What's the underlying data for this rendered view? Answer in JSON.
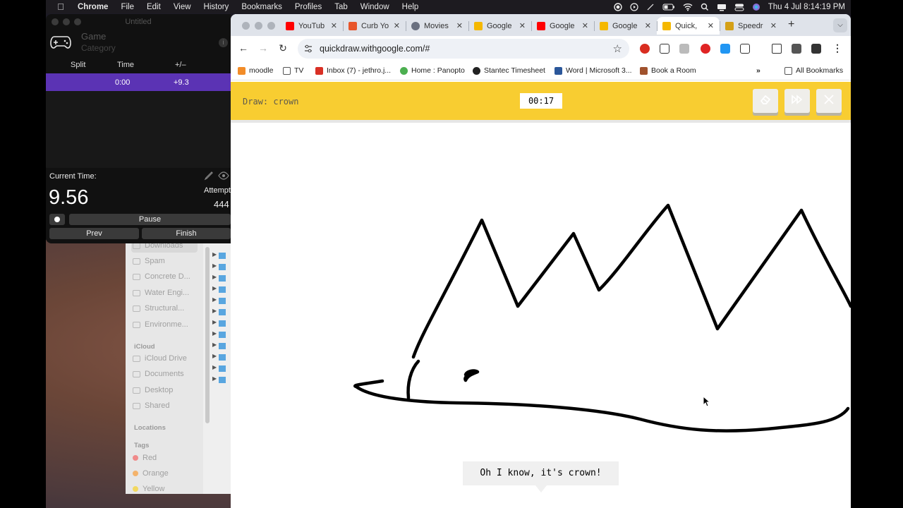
{
  "menubar": {
    "app": "Chrome",
    "items": [
      "File",
      "Edit",
      "View",
      "History",
      "Bookmarks",
      "Profiles",
      "Tab",
      "Window",
      "Help"
    ],
    "clock": "Thu 4 Jul  8:14:19 PM"
  },
  "timer_window": {
    "title": "Untitled",
    "game": "Game",
    "category": "Category",
    "columns": {
      "split": "Split",
      "time": "Time",
      "delta": "+/–"
    },
    "row": {
      "time": "0:00",
      "delta": "+9.3"
    },
    "current_time_label": "Current Time:",
    "current_time": "9.56",
    "attempts_label": "Attempt",
    "attempts": "444",
    "pause": "Pause",
    "prev": "Prev",
    "finish": "Finish"
  },
  "finder": {
    "items": [
      "Downloads",
      "Spam",
      "Concrete D...",
      "Water Engi...",
      "Structural...",
      "Environme..."
    ],
    "icloud_header": "iCloud",
    "icloud": [
      "iCloud Drive",
      "Documents",
      "Desktop",
      "Shared"
    ],
    "locations_header": "Locations",
    "tags_header": "Tags",
    "tags": [
      {
        "name": "Red",
        "color": "#f08a8a"
      },
      {
        "name": "Orange",
        "color": "#f4b36b"
      },
      {
        "name": "Yellow",
        "color": "#f2d860"
      }
    ]
  },
  "tabs": [
    {
      "title": "YouTub",
      "color": "#ff0000"
    },
    {
      "title": "Curb Yo",
      "color": "#e8552b"
    },
    {
      "title": "Movies",
      "color": "#6a7080"
    },
    {
      "title": "Google",
      "color": "#f5b800"
    },
    {
      "title": "Google",
      "color": "#ff0000"
    },
    {
      "title": "Google",
      "color": "#f5b800"
    },
    {
      "title": "Quick,",
      "color": "#f5b800",
      "active": true
    },
    {
      "title": "Speedr",
      "color": "#d4a017"
    }
  ],
  "omnibox": {
    "url": "quickdraw.withgoogle.com/#"
  },
  "bookmarks": [
    {
      "label": "moodle",
      "color": "#f28c28"
    },
    {
      "label": "TV",
      "color": "#666666"
    },
    {
      "label": "Inbox (7) - jethro.j...",
      "color": "#d93025"
    },
    {
      "label": "Home : Panopto",
      "color": "#4caf50"
    },
    {
      "label": "Stantec Timesheet",
      "color": "#222222"
    },
    {
      "label": "Word | Microsoft 3...",
      "color": "#2b579a"
    },
    {
      "label": "Book a Room",
      "color": "#a0522d"
    }
  ],
  "all_bookmarks": "All Bookmarks",
  "quickdraw": {
    "prompt": "Draw: crown",
    "timer": "00:17",
    "guess": "Oh I know, it's crown!",
    "accent": "#f8cd31"
  }
}
